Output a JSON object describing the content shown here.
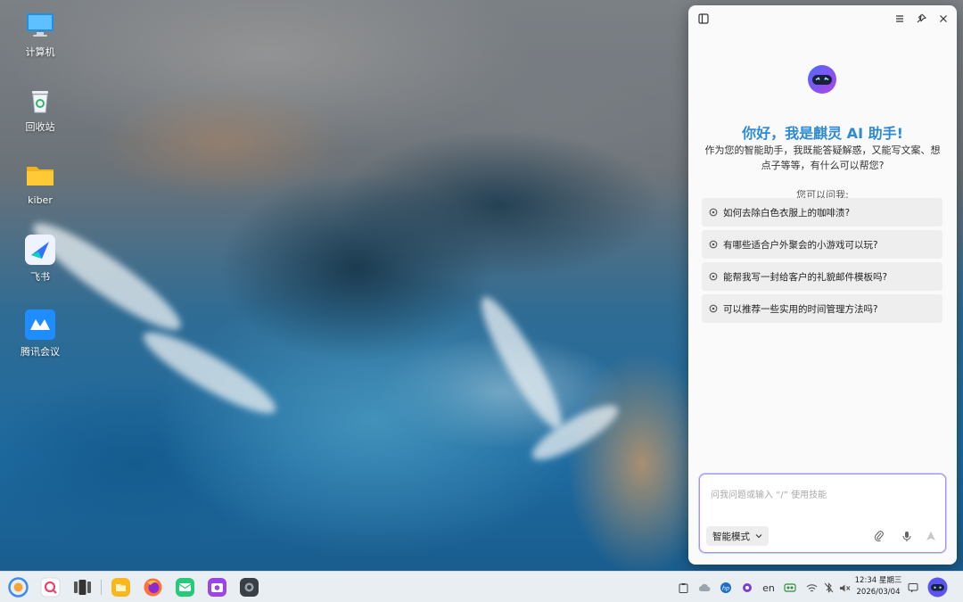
{
  "desktop": {
    "icons": [
      {
        "label": "计算机",
        "icon": "computer-icon"
      },
      {
        "label": "回收站",
        "icon": "trash-icon"
      },
      {
        "label": "kiber",
        "icon": "folder-icon"
      },
      {
        "label": "飞书",
        "icon": "feishu-icon"
      },
      {
        "label": "腾讯会议",
        "icon": "tencent-meeting-icon"
      }
    ]
  },
  "assistant": {
    "greeting": "你好，我是麒灵 AI 助手!",
    "intro": "作为您的智能助手，我既能答疑解惑，又能写文案、想点子等等，有什么可以帮您?",
    "ask_title": "您可以问我:",
    "suggestions": [
      "如何去除白色衣服上的咖啡渍?",
      "有哪些适合户外聚会的小游戏可以玩?",
      "能帮我写一封给客户的礼貌邮件模板吗?",
      "可以推荐一些实用的时间管理方法吗?"
    ],
    "input_placeholder": "问我问题或输入 “/” 使用技能",
    "mode_label": "智能模式",
    "accent_color": "#2e8ad6"
  },
  "taskbar": {
    "tray_lang": "en",
    "time": "12:34 星期三",
    "date": "2026/03/04"
  }
}
